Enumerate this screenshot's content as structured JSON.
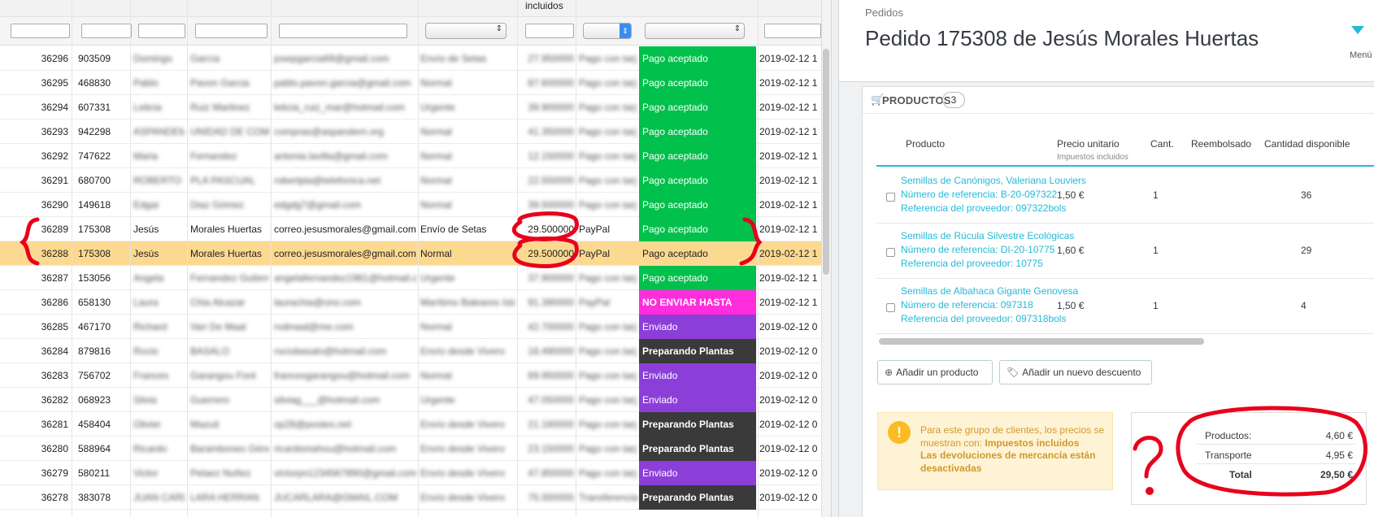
{
  "orders_table": {
    "header_taxes_label": "incluidos",
    "rows": [
      {
        "id": "36296",
        "ref": "903509",
        "first": "Domingo",
        "last": "García",
        "email": "josepgarcia69@gmail.com",
        "carrier": "Envío de Setas",
        "total": "27.950000",
        "payment": "Pago con tarj",
        "status": "Pago aceptado",
        "status_color": "#02c04c",
        "date": "2019-02-12 1",
        "blur": true
      },
      {
        "id": "36295",
        "ref": "468830",
        "first": "Pablo",
        "last": "Pavon Garcia",
        "email": "pablo.pavon.garcia@gmail.com",
        "carrier": "Normal",
        "total": "87.600000",
        "payment": "Pago con tarj",
        "status": "Pago aceptado",
        "status_color": "#02c04c",
        "date": "2019-02-12 1",
        "blur": true
      },
      {
        "id": "36294",
        "ref": "607331",
        "first": "Leticia",
        "last": "Ruiz Martinez",
        "email": "leticia_ruiz_mar@hotmail.com",
        "carrier": "Urgente",
        "total": "39.900000",
        "payment": "Pago con tarj",
        "status": "Pago aceptado",
        "status_color": "#02c04c",
        "date": "2019-02-12 1",
        "blur": true
      },
      {
        "id": "36293",
        "ref": "942298",
        "first": "ASPANDEM",
        "last": "UNIDAD DE COMP",
        "email": "compras@aspandem.org",
        "carrier": "Normal",
        "total": "41.350000",
        "payment": "Pago con tarj",
        "status": "Pago aceptado",
        "status_color": "#02c04c",
        "date": "2019-02-12 1",
        "blur": true
      },
      {
        "id": "36292",
        "ref": "747622",
        "first": "Maria",
        "last": "Fernandez",
        "email": "antonia.lavilla@gmail.com",
        "carrier": "Normal",
        "total": "12.150000",
        "payment": "Pago con tarj",
        "status": "Pago aceptado",
        "status_color": "#02c04c",
        "date": "2019-02-12 1",
        "blur": true
      },
      {
        "id": "36291",
        "ref": "680700",
        "first": "ROBERTO",
        "last": "PLA PASCUAL",
        "email": "robertpla@telefonica.net",
        "carrier": "Normal",
        "total": "22.550000",
        "payment": "Pago con tarj",
        "status": "Pago aceptado",
        "status_color": "#02c04c",
        "date": "2019-02-12 1",
        "blur": true
      },
      {
        "id": "36290",
        "ref": "149618",
        "first": "Edgar",
        "last": "Diaz Gómez",
        "email": "edgdg7@gmail.com",
        "carrier": "Normal",
        "total": "39.500000",
        "payment": "Pago con tarj",
        "status": "Pago aceptado",
        "status_color": "#02c04c",
        "date": "2019-02-12 1",
        "blur": true
      },
      {
        "id": "36289",
        "ref": "175308",
        "first": "Jesús",
        "last": "Morales Huertas",
        "email": "correo.jesusmorales@gmail.com",
        "carrier": "Envío de Setas",
        "total": "29.500000",
        "payment": "PayPal",
        "status": "Pago aceptado",
        "status_color": "#02c04c",
        "date": "2019-02-12 1",
        "blur": false
      },
      {
        "id": "36288",
        "ref": "175308",
        "first": "Jesús",
        "last": "Morales Huertas",
        "email": "correo.jesusmorales@gmail.com",
        "carrier": "Normal",
        "total": "29.500000",
        "payment": "PayPal",
        "status": "Pago aceptado",
        "status_color": "#fcd990",
        "date": "2019-02-12 1",
        "blur": false,
        "highlight": true
      },
      {
        "id": "36287",
        "ref": "153056",
        "first": "Angela",
        "last": "Fernandez Gutierr",
        "email": "angelafernandez1981@hotmail.com",
        "carrier": "Urgente",
        "total": "37.900000",
        "payment": "Pago con tarj",
        "status": "Pago aceptado",
        "status_color": "#02c04c",
        "date": "2019-02-12 1",
        "blur": true
      },
      {
        "id": "36286",
        "ref": "658130",
        "first": "Laura",
        "last": "Chia Alcazar",
        "email": "laurachia@ono.com",
        "carrier": "Marítimo Baleares Isla",
        "total": "91.390000",
        "payment": "PayPal",
        "status": "NO ENVIAR HASTA",
        "status_color": "#ff2ddc",
        "date": "2019-02-12 1",
        "blur": true
      },
      {
        "id": "36285",
        "ref": "467170",
        "first": "Richard",
        "last": "Van De Maal",
        "email": "rvdmaal@me.com",
        "carrier": "Normal",
        "total": "42.700000",
        "payment": "Pago con tarj",
        "status": "Enviado",
        "status_color": "#8c3fd8",
        "date": "2019-02-12 0",
        "blur": true
      },
      {
        "id": "36284",
        "ref": "879816",
        "first": "Rocio",
        "last": "BASALO",
        "email": "rociobasalo@hotmail.com",
        "carrier": "Envío desde Vivero",
        "total": "18.490000",
        "payment": "Pago con tarj",
        "status": "Preparando Plantas",
        "status_color": "#3a3a3a",
        "date": "2019-02-12 0",
        "blur": true
      },
      {
        "id": "36283",
        "ref": "756702",
        "first": "Frances",
        "last": "Garangou Font",
        "email": "francesgarangou@hotmail.com",
        "carrier": "Normal",
        "total": "69.950000",
        "payment": "Pago con tarj",
        "status": "Enviado",
        "status_color": "#8c3fd8",
        "date": "2019-02-12 0",
        "blur": true
      },
      {
        "id": "36282",
        "ref": "068923",
        "first": "Silvia",
        "last": "Guerrero",
        "email": "silviag___@hotmail.com",
        "carrier": "Urgente",
        "total": "47.050000",
        "payment": "Pago con tarj",
        "status": "Enviado",
        "status_color": "#8c3fd8",
        "date": "2019-02-12 0",
        "blur": true
      },
      {
        "id": "36281",
        "ref": "458404",
        "first": "Olivier",
        "last": "Mazuit",
        "email": "op28@posteo.net",
        "carrier": "Envío desde Vivero",
        "total": "21.160000",
        "payment": "Pago con tarj",
        "status": "Preparando Plantas",
        "status_color": "#3a3a3a",
        "date": "2019-02-12 0",
        "blur": true
      },
      {
        "id": "36280",
        "ref": "588964",
        "first": "Ricardo",
        "last": "Barambones Géne",
        "email": "ricardomahou@hotmail.com",
        "carrier": "Envío desde Vivero",
        "total": "23.150000",
        "payment": "Pago con tarj",
        "status": "Preparando Plantas",
        "status_color": "#3a3a3a",
        "date": "2019-02-12 0",
        "blur": true
      },
      {
        "id": "36279",
        "ref": "580211",
        "first": "Victor",
        "last": "Pelaez Nuñez",
        "email": "victorpn1234567890@gmail.com",
        "carrier": "Envío desde Vivero",
        "total": "47.850000",
        "payment": "Pago con tarj",
        "status": "Enviado",
        "status_color": "#8c3fd8",
        "date": "2019-02-12 0",
        "blur": true
      },
      {
        "id": "36278",
        "ref": "383078",
        "first": "JUAN CARLO",
        "last": "LARA HERRAN",
        "email": "JUCARLARA@GMAIL.COM",
        "carrier": "Envío desde Vivero",
        "total": "75.000000",
        "payment": "Transferencia",
        "status": "Preparando Plantas",
        "status_color": "#3a3a3a",
        "date": "2019-02-12 0",
        "blur": true
      }
    ]
  },
  "order_panel": {
    "breadcrumb": "Pedidos",
    "title": "Pedido 175308 de Jesús Morales Huertas",
    "menu_label": "Menú",
    "products_title": "PRODUCTOS",
    "products_count": "3",
    "columns": {
      "product": "Producto",
      "unit_price": "Precio unitario",
      "unit_price_sub": "Impuestos incluidos",
      "qty": "Cant.",
      "refunded": "Reembolsado",
      "available": "Cantidad disponible"
    },
    "products": [
      {
        "name": "Semillas de Canónigos, Valeriana Louviers",
        "ref": "Número de referencia: B-20-097322",
        "supplier_ref": "Referencia del proveedor: 097322bols",
        "price": "1,50 €",
        "qty": "1",
        "stock": "36"
      },
      {
        "name": "Semillas de Rúcula Silvestre Ecológicas",
        "ref": "Número de referencia: DI-20-10775",
        "supplier_ref": "Referencia del proveedor: 10775",
        "price": "1,60 €",
        "qty": "1",
        "stock": "29"
      },
      {
        "name": "Semillas de Albahaca Gigante Genovesa",
        "ref": "Número de referencia: 097318",
        "supplier_ref": "Referencia del proveedor: 097318bols",
        "price": "1,50 €",
        "qty": "1",
        "stock": "4"
      }
    ],
    "add_product_btn": "Añadir un producto",
    "add_discount_btn": "Añadir un nuevo descuento",
    "alert": {
      "text1": "Para este grupo de clientes, los precios se muestran con:",
      "bold1": "Impuestos incluidos",
      "bold2": "Las devoluciones de mercancía están desactivadas"
    },
    "totals": {
      "products_label": "Productos:",
      "products_value": "4,60 €",
      "shipping_label": "Transporte",
      "shipping_value": "4,95 €",
      "total_label": "Total",
      "total_value": "29,50 €"
    }
  },
  "colors": {
    "accent": "#25b9d7",
    "highlight_row": "#fcd990",
    "status_accepted": "#02c04c",
    "status_hold": "#ff2ddc",
    "status_shipped": "#8c3fd8",
    "status_preparing": "#3a3a3a",
    "annotation_red": "#e8001c"
  }
}
